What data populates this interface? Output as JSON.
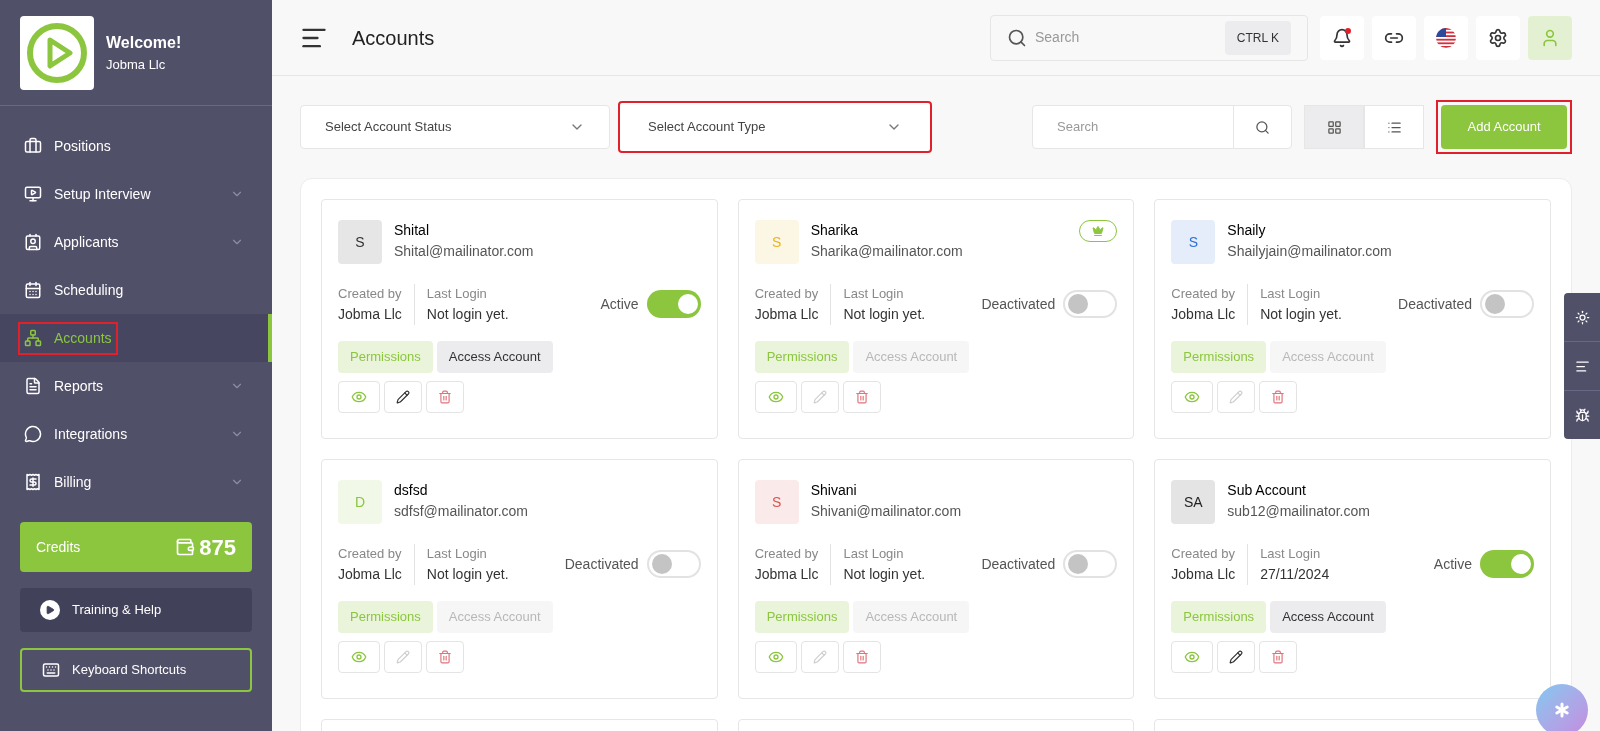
{
  "sidebar": {
    "welcome": "Welcome!",
    "company": "Jobma Llc",
    "items": [
      {
        "label": "Positions",
        "expandable": false,
        "selected": false,
        "highlighted": false
      },
      {
        "label": "Setup Interview",
        "expandable": true,
        "selected": false,
        "highlighted": false
      },
      {
        "label": "Applicants",
        "expandable": true,
        "selected": false,
        "highlighted": false
      },
      {
        "label": "Scheduling",
        "expandable": false,
        "selected": false,
        "highlighted": false
      },
      {
        "label": "Accounts",
        "expandable": false,
        "selected": true,
        "highlighted": true
      },
      {
        "label": "Reports",
        "expandable": true,
        "selected": false,
        "highlighted": false
      },
      {
        "label": "Integrations",
        "expandable": true,
        "selected": false,
        "highlighted": false
      },
      {
        "label": "Billing",
        "expandable": true,
        "selected": false,
        "highlighted": false
      }
    ],
    "credits": {
      "label": "Credits",
      "value": "875"
    },
    "training": "Training & Help",
    "shortcuts": "Keyboard Shortcuts"
  },
  "header": {
    "title": "Accounts",
    "search": {
      "placeholder": "Search",
      "shortcut": "CTRL K"
    },
    "notification_dot": true
  },
  "filters": {
    "status_select": {
      "placeholder": "Select Account Status",
      "highlighted": false
    },
    "type_select": {
      "placeholder": "Select Account Type",
      "highlighted": true
    },
    "search": {
      "placeholder": "Search"
    },
    "views": [
      {
        "kind": "grid",
        "selected": true
      },
      {
        "kind": "list",
        "selected": false
      }
    ],
    "add_button": {
      "label": "Add Account",
      "highlighted": true
    }
  },
  "accounts": [
    {
      "initials": "S",
      "color": "#333333",
      "name": "Shital",
      "email": "Shital@mailinator.com",
      "premium": false,
      "created_by_label": "Created by",
      "created_by": "Jobma Llc",
      "last_login_label": "Last Login",
      "last_login": "Not login yet.",
      "status": "Active",
      "on": true,
      "permissions": "Permissions",
      "access": "Access Account",
      "access_enabled": true,
      "edit_enabled": true
    },
    {
      "initials": "S",
      "color": "#e6b422",
      "name": "Sharika",
      "email": "Sharika@mailinator.com",
      "premium": true,
      "created_by_label": "Created by",
      "created_by": "Jobma Llc",
      "last_login_label": "Last Login",
      "last_login": "Not login yet.",
      "status": "Deactivated",
      "on": false,
      "permissions": "Permissions",
      "access": "Access Account",
      "access_enabled": false,
      "edit_enabled": false
    },
    {
      "initials": "S",
      "color": "#2f6fd6",
      "name": "Shaily",
      "email": "Shailyjain@mailinator.com",
      "premium": false,
      "created_by_label": "Created by",
      "created_by": "Jobma Llc",
      "last_login_label": "Last Login",
      "last_login": "Not login yet.",
      "status": "Deactivated",
      "on": false,
      "permissions": "Permissions",
      "access": "Access Account",
      "access_enabled": false,
      "edit_enabled": false
    },
    {
      "initials": "D",
      "color": "#8cc63f",
      "name": "dsfsd",
      "email": "sdfsf@mailinator.com",
      "premium": false,
      "created_by_label": "Created by",
      "created_by": "Jobma Llc",
      "last_login_label": "Last Login",
      "last_login": "Not login yet.",
      "status": "Deactivated",
      "on": false,
      "permissions": "Permissions",
      "access": "Access Account",
      "access_enabled": false,
      "edit_enabled": false
    },
    {
      "initials": "S",
      "color": "#d9534f",
      "name": "Shivani",
      "email": "Shivani@mailinator.com",
      "premium": false,
      "created_by_label": "Created by",
      "created_by": "Jobma Llc",
      "last_login_label": "Last Login",
      "last_login": "Not login yet.",
      "status": "Deactivated",
      "on": false,
      "permissions": "Permissions",
      "access": "Access Account",
      "access_enabled": false,
      "edit_enabled": false
    },
    {
      "initials": "SA",
      "color": "#222222",
      "name": "Sub Account",
      "email": "sub12@mailinator.com",
      "premium": false,
      "created_by_label": "Created by",
      "created_by": "Jobma Llc",
      "last_login_label": "Last Login",
      "last_login": "27/11/2024",
      "status": "Active",
      "on": true,
      "permissions": "Permissions",
      "access": "Access Account",
      "access_enabled": true,
      "edit_enabled": true
    }
  ]
}
